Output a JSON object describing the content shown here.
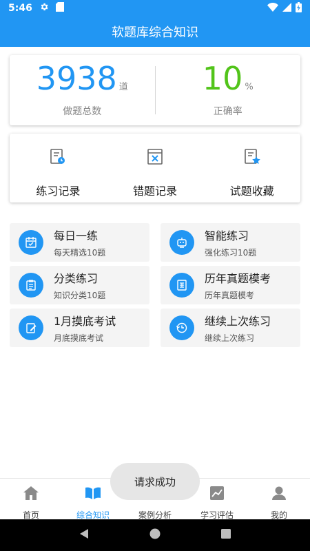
{
  "status_bar": {
    "time": "5:46"
  },
  "header": {
    "title": "软题库综合知识"
  },
  "stats": {
    "total": {
      "value": "3938",
      "unit": "道",
      "label": "做题总数"
    },
    "accuracy": {
      "value": "10",
      "unit": "%",
      "label": "正确率"
    }
  },
  "actions": [
    {
      "label": "练习记录",
      "icon": "practice-record-icon"
    },
    {
      "label": "错题记录",
      "icon": "wrong-questions-icon"
    },
    {
      "label": "试题收藏",
      "icon": "favorites-icon"
    }
  ],
  "modules": [
    {
      "title": "每日一练",
      "subtitle": "每天精选10题",
      "icon": "calendar-icon"
    },
    {
      "title": "智能练习",
      "subtitle": "强化练习10题",
      "icon": "robot-icon"
    },
    {
      "title": "分类练习",
      "subtitle": "知识分类10题",
      "icon": "clipboard-icon"
    },
    {
      "title": "历年真题模考",
      "subtitle": "历年真题模考",
      "icon": "exam-paper-icon"
    },
    {
      "title": "1月摸底考试",
      "subtitle": "月底摸底考试",
      "icon": "edit-icon"
    },
    {
      "title": "继续上次练习",
      "subtitle": "继续上次练习",
      "icon": "history-icon"
    }
  ],
  "bottom_nav": [
    {
      "label": "首页",
      "icon": "home-icon",
      "active": false
    },
    {
      "label": "综合知识",
      "icon": "book-icon",
      "active": true
    },
    {
      "label": "案例分析",
      "icon": "case-analysis-icon",
      "active": false
    },
    {
      "label": "学习评估",
      "icon": "trend-chart-icon",
      "active": false
    },
    {
      "label": "我的",
      "icon": "user-icon",
      "active": false
    }
  ],
  "toast": {
    "message": "请求成功"
  },
  "colors": {
    "primary": "#2196f3",
    "success": "#52c41a",
    "tile_bg": "#f4f4f4"
  }
}
